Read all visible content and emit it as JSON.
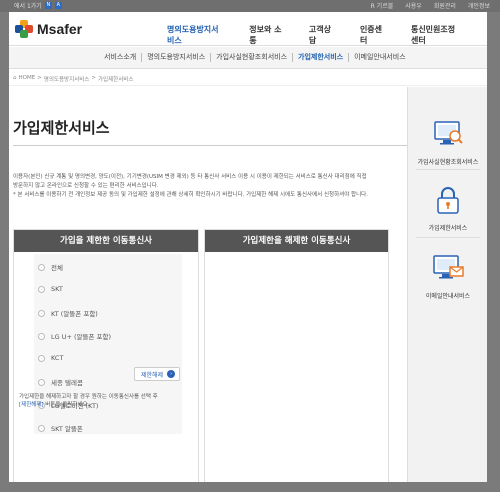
{
  "topbar": {
    "left_text": "에서 1가기",
    "badge_1": "N",
    "badge_2": "A",
    "links": [
      "R 기르블",
      "사용우",
      "회원관리",
      "개인정보"
    ]
  },
  "header": {
    "logo": "Msafer",
    "menu": [
      "명의도용방지서비스",
      "정보와 소통",
      "고객상담",
      "인증센터",
      "통신민원조정센터"
    ],
    "active_index": 0
  },
  "subnav": {
    "items": [
      "서비스소개",
      "명의도용방지서비스",
      "가입사실현황조회서비스",
      "가입제한서비스",
      "이메일안내서비스"
    ],
    "active_index": 3
  },
  "breadcrumb": [
    "HOME",
    ">",
    "명의도용방지서비스",
    ">",
    "가입제한서비스"
  ],
  "page": {
    "title": "가입제한서비스",
    "description": [
      "이용자(본인) 신규 계통 및 명의변경, 양도(이전), 기기변경(USIM 변경 제외) 등 타 통신사 서비스 이용 시 이용이 제한되는 서비스로 통신사 대리점에 직접",
      "방문하지 않고 온라인으로 신청할 수 있는 편리한 서비스입니다.",
      "* 본 서비스를 이용하기 전 개인정보 제공 동의 및 가입제한 설정에 관해 상세히 확인하시기 바랍니다. 가입제한 해제 시에도 통신사에서 신청하셔야 합니다."
    ]
  },
  "panel_restrict": {
    "header": "가입을 제한한 이동통신사",
    "carriers": [
      "전체",
      "SKT",
      "KT (알뜰폰 포함)",
      "LG U+ (알뜰폰 포함)",
      "KCT",
      "세종 텔레콤",
      "LG헬로비전 (KT)",
      "SKT 알뜰폰"
    ],
    "button": "제한해제"
  },
  "panel_release": {
    "header": "가입제한을 해제한 이동통신사"
  },
  "note": {
    "text": "가입제한을 해제하고자 할 경우 원하는 이동통신사를 선택 후",
    "link": "[제한해제]",
    "text_after": "버튼을 클릭하세요."
  },
  "sidebar": {
    "items": [
      "가입사실현황조회서비스",
      "가입제한서비스",
      "이메일안내서비스"
    ]
  },
  "colors": {
    "accent": "#1f5fb0",
    "panel_header": "#555555",
    "overlay": "#7b7b7b"
  }
}
